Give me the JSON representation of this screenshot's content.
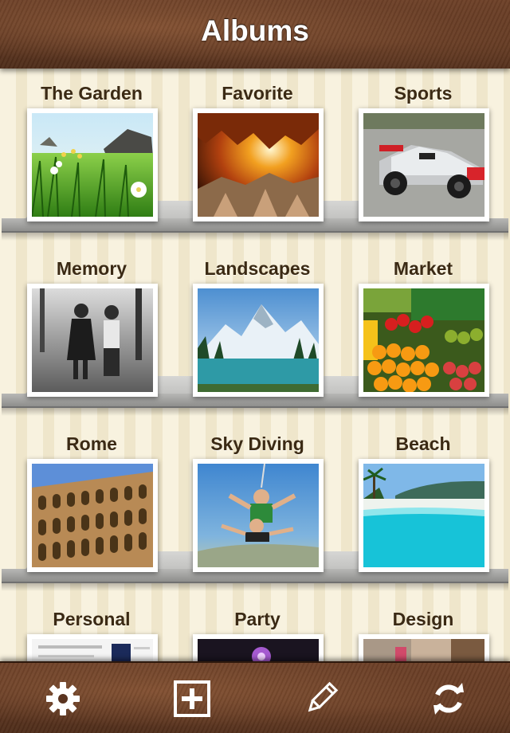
{
  "header": {
    "title": "Albums"
  },
  "albums": [
    {
      "name": "The Garden"
    },
    {
      "name": "Favorite"
    },
    {
      "name": "Sports"
    },
    {
      "name": "Memory"
    },
    {
      "name": "Landscapes"
    },
    {
      "name": "Market"
    },
    {
      "name": "Rome"
    },
    {
      "name": "Sky Diving"
    },
    {
      "name": "Beach"
    },
    {
      "name": "Personal"
    },
    {
      "name": "Party"
    },
    {
      "name": "Design"
    }
  ],
  "toolbar": {
    "icons": [
      "gear-icon",
      "add-album-icon",
      "pencil-icon",
      "refresh-icon"
    ]
  },
  "colors": {
    "header_leather": "#5e3820",
    "label_text": "#3b2a14",
    "wall_stripe_light": "#f8f2df",
    "wall_stripe_dark": "#efe6cb",
    "shelf": "#c3c3c1"
  }
}
